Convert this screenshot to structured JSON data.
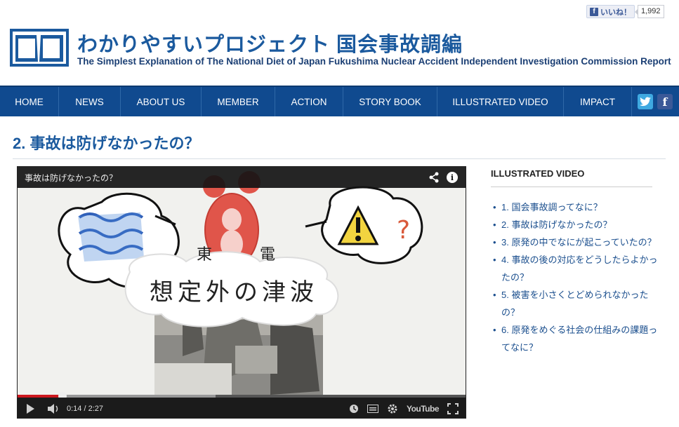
{
  "facebook": {
    "like_label": "いいね！",
    "count": "1,992"
  },
  "site": {
    "title_ja": "わかりやすいプロジェクト 国会事故調編",
    "title_en": "The Simplest Explanation of The National Diet of Japan Fukushima Nuclear Accident Independent Investigation Commission Report"
  },
  "nav": {
    "items": [
      "HOME",
      "NEWS",
      "ABOUT US",
      "MEMBER",
      "ACTION",
      "STORY BOOK",
      "ILLUSTRATED VIDEO",
      "IMPACT"
    ],
    "social": [
      "twitter-icon",
      "facebook-icon"
    ]
  },
  "page": {
    "title": "2. 事故は防げなかったの？"
  },
  "video": {
    "title": "事故は防げなかったの？",
    "frame_text": {
      "top_left": "東",
      "top_right": "電",
      "main": "想定外の津波",
      "question": "?"
    },
    "time": "0:14 / 2:27",
    "progress_played": 0.1,
    "progress_buffered": 0.44,
    "yt_label": "YouTube",
    "colors": {
      "played": "#cc181e",
      "title_bar": "#141414"
    }
  },
  "sidebar": {
    "title": "ILLUSTRATED VIDEO",
    "items": [
      "1. 国会事故調ってなに？",
      "2. 事故は防げなかったの？",
      "3. 原発の中でなにが起こっていたの？",
      "4. 事故の後の対応をどうしたらよかったの？",
      "5. 被害を小さくとどめられなかったの？",
      "6. 原発をめぐる社会の仕組みの課題ってなに？"
    ]
  },
  "colors": {
    "brand_blue": "#1b5a9e",
    "nav_bg": "#104a8f"
  }
}
